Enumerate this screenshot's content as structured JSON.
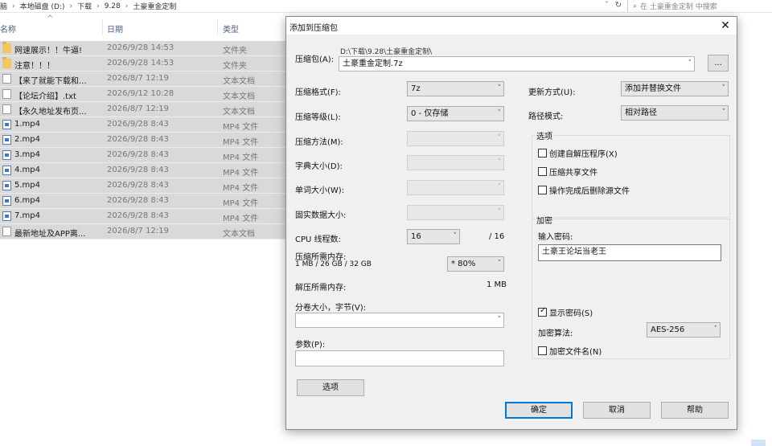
{
  "explorer": {
    "breadcrumbs": [
      "脑",
      "本地磁盘 (D:)",
      "下载",
      "9.28",
      "土豪重金定制"
    ],
    "search_placeholder": "在 土豪重金定制 中搜索",
    "columns": {
      "name": "名称",
      "date": "日期",
      "type": "类型"
    },
    "files": [
      {
        "icon": "folder",
        "name": "网速展示！！牛逼!",
        "date": "2026/9/28 14:53",
        "type": "文件夹"
      },
      {
        "icon": "folder",
        "name": "注意！！！",
        "date": "2026/9/28 14:53",
        "type": "文件夹"
      },
      {
        "icon": "txt",
        "name": "【来了就能下载和...",
        "date": "2026/8/7 12:19",
        "type": "文本文档"
      },
      {
        "icon": "txt",
        "name": "【论坛介绍】.txt",
        "date": "2026/9/12 10:28",
        "type": "文本文档"
      },
      {
        "icon": "txt",
        "name": "【永久地址发布页...",
        "date": "2026/8/7 12:19",
        "type": "文本文档"
      },
      {
        "icon": "mp4",
        "name": "1.mp4",
        "date": "2026/9/28 8:43",
        "type": "MP4 文件"
      },
      {
        "icon": "mp4",
        "name": "2.mp4",
        "date": "2026/9/28 8:43",
        "type": "MP4 文件"
      },
      {
        "icon": "mp4",
        "name": "3.mp4",
        "date": "2026/9/28 8:43",
        "type": "MP4 文件"
      },
      {
        "icon": "mp4",
        "name": "4.mp4",
        "date": "2026/9/28 8:43",
        "type": "MP4 文件"
      },
      {
        "icon": "mp4",
        "name": "5.mp4",
        "date": "2026/9/28 8:43",
        "type": "MP4 文件"
      },
      {
        "icon": "mp4",
        "name": "6.mp4",
        "date": "2026/9/28 8:43",
        "type": "MP4 文件"
      },
      {
        "icon": "mp4",
        "name": "7.mp4",
        "date": "2026/9/28 8:43",
        "type": "MP4 文件"
      },
      {
        "icon": "txt",
        "name": "最新地址及APP离...",
        "date": "2026/8/7 12:19",
        "type": "文本文档"
      }
    ]
  },
  "dialog": {
    "title": "添加到压缩包",
    "close_glyph": "✕",
    "archive": {
      "label": "压缩包(A):",
      "path": "D:\\下载\\9.28\\土豪重金定制\\",
      "filename": "土豪重金定制.7z",
      "browse_label": "..."
    },
    "format": {
      "label": "压缩格式(F):",
      "value": "7z"
    },
    "level": {
      "label": "压缩等级(L):",
      "value": "0 - 仅存储"
    },
    "method": {
      "label": "压缩方法(M):",
      "value": ""
    },
    "dict": {
      "label": "字典大小(D):",
      "value": ""
    },
    "word": {
      "label": "单词大小(W):",
      "value": ""
    },
    "solid": {
      "label": "固实数据大小:",
      "value": ""
    },
    "threads": {
      "label": "CPU 线程数:",
      "value": "16",
      "max": "/ 16"
    },
    "mem_compress": {
      "label": "压缩所需内存:",
      "detail": "1 MB / 26 GB / 32 GB",
      "value": "* 80%"
    },
    "mem_decompress": {
      "label": "解压所需内存:",
      "value": "1 MB"
    },
    "split": {
      "label": "分卷大小，字节(V):",
      "value": ""
    },
    "params": {
      "label": "参数(P):",
      "value": ""
    },
    "options_button": "选项",
    "update_mode": {
      "label": "更新方式(U):",
      "value": "添加并替换文件"
    },
    "path_mode": {
      "label": "路径模式:",
      "value": "相对路径"
    },
    "options_group": {
      "title": "选项",
      "sfx": {
        "label": "创建自解压程序(X)",
        "checked": false
      },
      "shared": {
        "label": "压缩共享文件",
        "checked": false
      },
      "delete": {
        "label": "操作完成后删除源文件",
        "checked": false
      }
    },
    "encryption": {
      "title": "加密",
      "password_label": "输入密码:",
      "password_value": "土豪王论坛当老王",
      "show_password": {
        "label": "显示密码(S)",
        "checked": true
      },
      "method_label": "加密算法:",
      "method_value": "AES-256",
      "encrypt_names": {
        "label": "加密文件名(N)",
        "checked": false
      }
    },
    "buttons": {
      "ok": "确定",
      "cancel": "取消",
      "help": "帮助"
    }
  }
}
